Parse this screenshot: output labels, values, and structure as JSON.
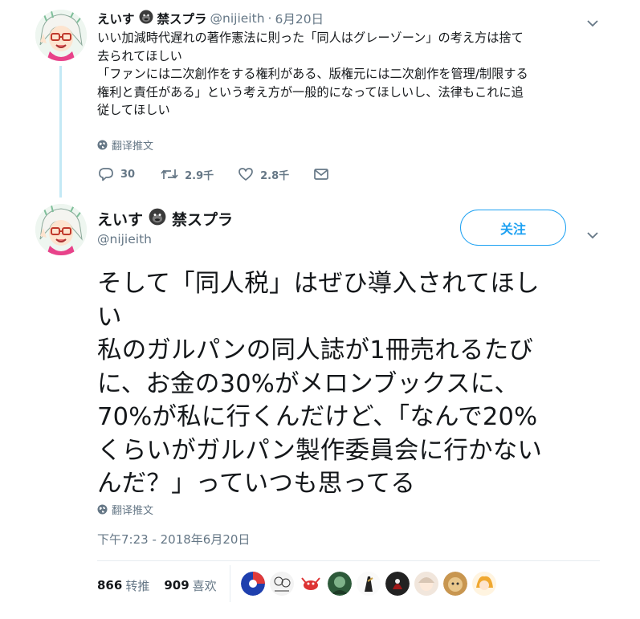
{
  "tweet1": {
    "display_name": "えいす",
    "name_suffix": "禁スプラ",
    "name_emoji_icon": "gorilla-icon",
    "handle": "@nijieith",
    "separator": "·",
    "date": "6月20日",
    "text_lines": [
      "いい加減時代遅れの著作憲法に則った「同人はグレーゾーン」の考え方は捨て",
      "去られてほしい",
      "「ファンには二次創作をする権利がある、版権元には二次創作を管理/制限する",
      "権利と責任がある」という考え方が一般的になってほしいし、法律もこれに追",
      "従してほしい"
    ],
    "translate_label": "翻译推文",
    "actions": {
      "reply_count": "30",
      "retweet_count": "2.9千",
      "like_count": "2.8千"
    }
  },
  "tweet2": {
    "display_name": "えいす",
    "name_suffix": "禁スプラ",
    "name_emoji_icon": "gorilla-icon",
    "handle": "@nijieith",
    "follow_label": "关注",
    "text_lines": [
      "そして「同人税」はぜひ導入されてほし",
      "い",
      "私のガルパンの同人誌が1冊売れるたび",
      "に、お金の30%がメロンブックスに、",
      "70%が私に行くんだけど、「なんで20%",
      "くらいがガルパン製作委員会に行かない",
      "んだ？」っていつも思ってる"
    ],
    "translate_label": "翻译推文",
    "timestamp": "下午7:23 - 2018年6月20日",
    "retweets": {
      "count": "866",
      "label": "转推"
    },
    "likes": {
      "count": "909",
      "label": "喜欢"
    },
    "liker_avatar_count": 9
  },
  "colors": {
    "accent": "#1da1f2",
    "muted_text": "#657786",
    "thread_line": "#c4e9f5",
    "divider": "#e6ecf0"
  }
}
